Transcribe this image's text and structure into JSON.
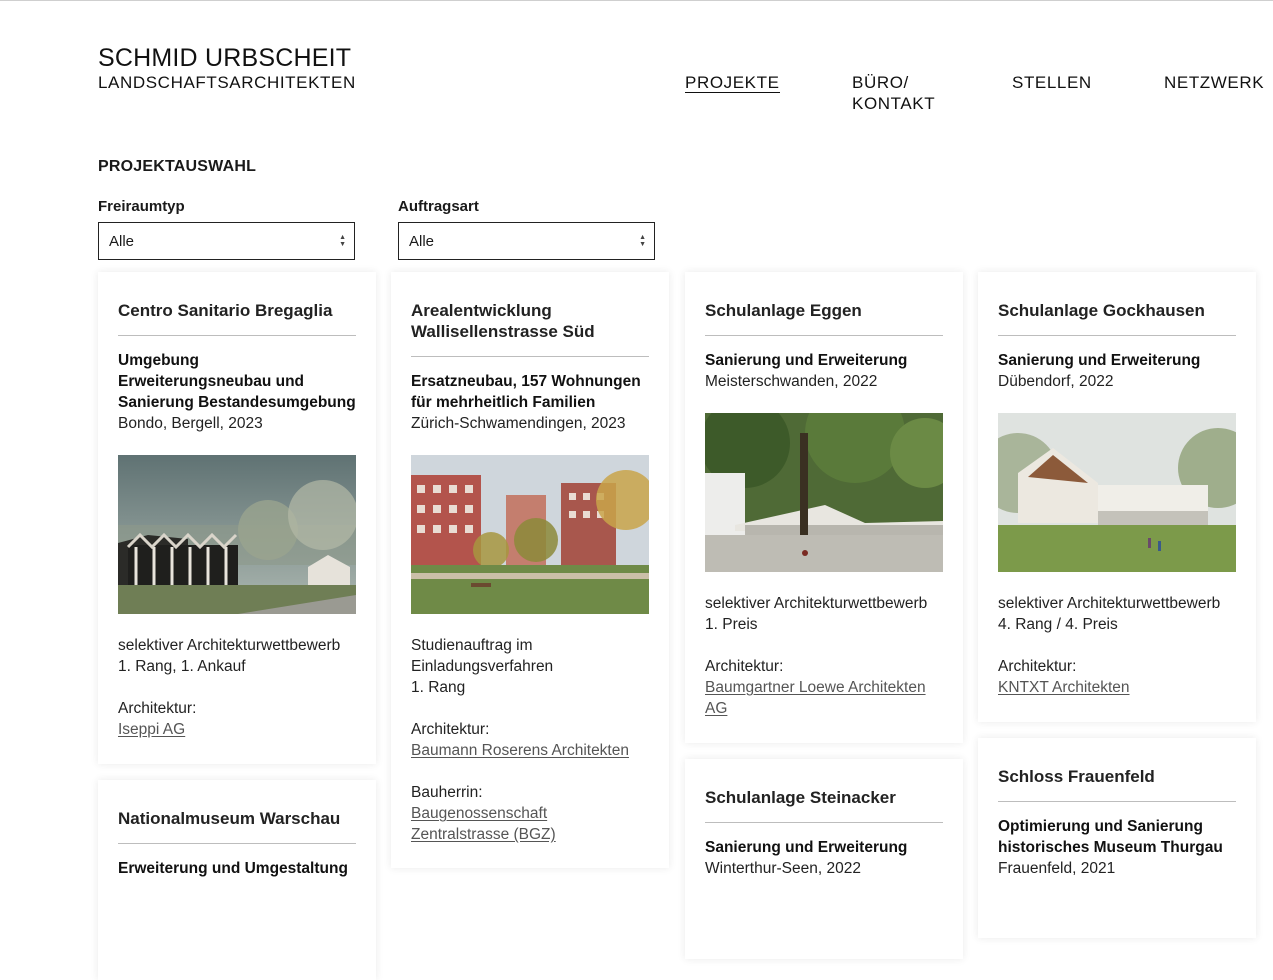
{
  "brand": {
    "name": "SCHMID URBSCHEIT",
    "tagline": "LANDSCHAFTSARCHITEKTEN"
  },
  "nav": {
    "projekte": "PROJEKTE",
    "buero_line1": "BÜRO/",
    "buero_line2": "KONTAKT",
    "stellen": "STELLEN",
    "netzwerk": "NETZWERK"
  },
  "section_title": "PROJEKTAUSWAHL",
  "filters": {
    "freiraumtyp": {
      "label": "Freiraumtyp",
      "value": "Alle"
    },
    "auftragsart": {
      "label": "Auftragsart",
      "value": "Alle"
    }
  },
  "projects": {
    "bregaglia": {
      "title": "Centro Sanitario Bregaglia",
      "type_1": "Umgebung",
      "type_2": "Erweiterungsneubau und",
      "type_3": "Sanierung Bestandesumgebung",
      "location": "Bondo, Bergell, 2023",
      "procedure": "selektiver Architekturwettbewerb",
      "result": "1. Rang, 1. Ankauf",
      "architect_label": "Architektur:",
      "architect": "Iseppi AG"
    },
    "wallisellen": {
      "title_1": "Arealentwicklung",
      "title_2": "Wallisellenstrasse Süd",
      "type_1": "Ersatzneubau, 157 Wohnungen",
      "type_2": "für mehrheitlich Familien",
      "location": "Zürich-Schwamendingen, 2023",
      "procedure_1": "Studienauftrag im",
      "procedure_2": "Einladungsverfahren",
      "result": "1. Rang",
      "architect_label": "Architektur:",
      "architect": "Baumann Roserens Architekten",
      "client_label": "Bauherrin:",
      "client_1": "Baugenossenschaft",
      "client_2": "Zentralstrasse (BGZ)"
    },
    "eggen": {
      "title": "Schulanlage Eggen",
      "type": "Sanierung und Erweiterung",
      "location": "Meisterschwanden, 2022",
      "procedure": "selektiver Architekturwettbewerb",
      "result": "1. Preis",
      "architect_label": "Architektur:",
      "architect_1": "Baumgartner Loewe Architekten",
      "architect_2": "AG"
    },
    "gockhausen": {
      "title": "Schulanlage Gockhausen",
      "type": "Sanierung und Erweiterung",
      "location": "Dübendorf, 2022",
      "procedure": "selektiver Architekturwettbewerb",
      "result": "4. Rang / 4. Preis",
      "architect_label": "Architektur:",
      "architect": "KNTXT Architekten"
    },
    "warschau": {
      "title": "Nationalmuseum Warschau",
      "type": "Erweiterung und Umgestaltung"
    },
    "steinacker": {
      "title": "Schulanlage Steinacker",
      "type": "Sanierung und Erweiterung",
      "location": "Winterthur-Seen, 2022"
    },
    "frauenfeld": {
      "title": "Schloss Frauenfeld",
      "type_1": "Optimierung und Sanierung",
      "type_2": "historisches Museum Thurgau",
      "location": "Frauenfeld, 2021"
    }
  }
}
